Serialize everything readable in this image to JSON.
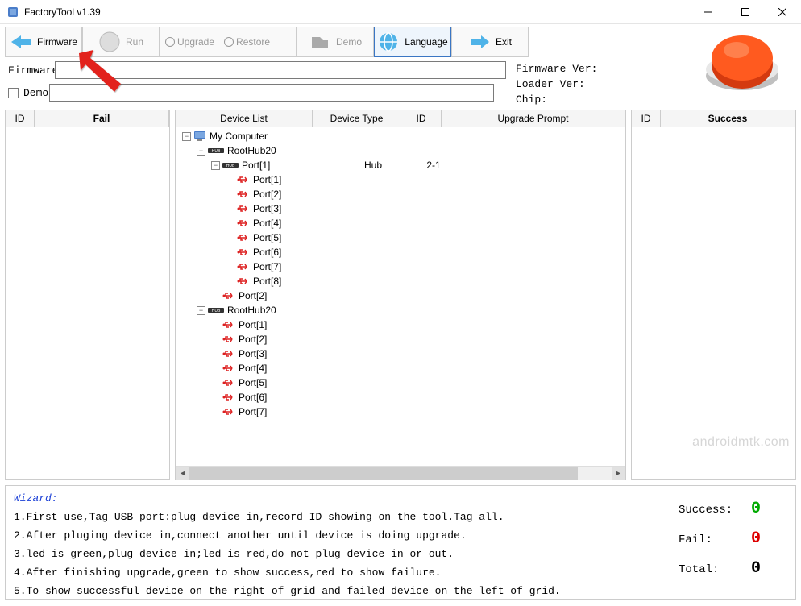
{
  "window": {
    "title": "FactoryTool v1.39"
  },
  "toolbar": {
    "firmware": "Firmware",
    "run": "Run",
    "upgrade": "Upgrade",
    "restore": "Restore",
    "demo": "Demo",
    "language": "Language",
    "exit": "Exit"
  },
  "form": {
    "firmware_label": "Firmware",
    "firmware_value": "",
    "demo_label": "Demo",
    "demo_value": ""
  },
  "info": {
    "firmware_ver_label": "Firmware Ver:",
    "firmware_ver_value": "",
    "loader_ver_label": "Loader Ver:",
    "loader_ver_value": "",
    "chip_label": "Chip:",
    "chip_value": ""
  },
  "left_panel": {
    "col_id": "ID",
    "col_fail": "Fail"
  },
  "right_panel": {
    "col_id": "ID",
    "col_success": "Success"
  },
  "center": {
    "cols": {
      "device_list": "Device List",
      "device_type": "Device Type",
      "id": "ID",
      "upgrade_prompt": "Upgrade Prompt"
    },
    "tree": [
      {
        "depth": 0,
        "toggle": "-",
        "icon": "computer",
        "label": "My Computer"
      },
      {
        "depth": 1,
        "toggle": "-",
        "icon": "hub",
        "label": "RootHub20"
      },
      {
        "depth": 2,
        "toggle": "-",
        "icon": "hub",
        "label": "Port[1]",
        "device_type": "Hub",
        "id": "2-1"
      },
      {
        "depth": 3,
        "toggle": "",
        "icon": "usb",
        "label": "Port[1]"
      },
      {
        "depth": 3,
        "toggle": "",
        "icon": "usb",
        "label": "Port[2]"
      },
      {
        "depth": 3,
        "toggle": "",
        "icon": "usb",
        "label": "Port[3]"
      },
      {
        "depth": 3,
        "toggle": "",
        "icon": "usb",
        "label": "Port[4]"
      },
      {
        "depth": 3,
        "toggle": "",
        "icon": "usb",
        "label": "Port[5]"
      },
      {
        "depth": 3,
        "toggle": "",
        "icon": "usb",
        "label": "Port[6]"
      },
      {
        "depth": 3,
        "toggle": "",
        "icon": "usb",
        "label": "Port[7]"
      },
      {
        "depth": 3,
        "toggle": "",
        "icon": "usb",
        "label": "Port[8]"
      },
      {
        "depth": 2,
        "toggle": "",
        "icon": "usb",
        "label": "Port[2]"
      },
      {
        "depth": 1,
        "toggle": "-",
        "icon": "hub",
        "label": "RootHub20"
      },
      {
        "depth": 2,
        "toggle": "",
        "icon": "usb",
        "label": "Port[1]"
      },
      {
        "depth": 2,
        "toggle": "",
        "icon": "usb",
        "label": "Port[2]"
      },
      {
        "depth": 2,
        "toggle": "",
        "icon": "usb",
        "label": "Port[3]"
      },
      {
        "depth": 2,
        "toggle": "",
        "icon": "usb",
        "label": "Port[4]"
      },
      {
        "depth": 2,
        "toggle": "",
        "icon": "usb",
        "label": "Port[5]"
      },
      {
        "depth": 2,
        "toggle": "",
        "icon": "usb",
        "label": "Port[6]"
      },
      {
        "depth": 2,
        "toggle": "",
        "icon": "usb",
        "label": "Port[7]"
      }
    ]
  },
  "wizard": {
    "title": "Wizard:",
    "lines": [
      "1.First use,Tag USB port:plug device in,record ID showing on the tool.Tag all.",
      "2.After pluging device in,connect another until device is doing upgrade.",
      "3.led is green,plug device in;led is red,do not plug device in or out.",
      "4.After finishing upgrade,green to show success,red to show failure.",
      "5.To show successful device on the right of grid and failed device on the left of grid."
    ]
  },
  "stats": {
    "success_label": "Success:",
    "success_value": "0",
    "fail_label": "Fail:",
    "fail_value": "0",
    "total_label": "Total:",
    "total_value": "0"
  },
  "watermark": "androidmtk.com"
}
